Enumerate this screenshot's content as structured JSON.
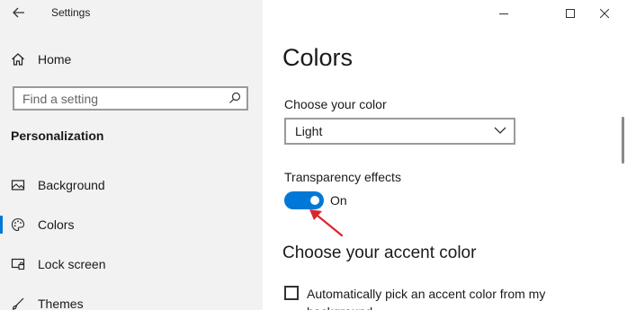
{
  "window": {
    "title": "Settings",
    "controls": [
      "minimize-icon",
      "maximize-icon",
      "close-icon"
    ]
  },
  "sidebar": {
    "home_label": "Home",
    "search": {
      "placeholder": "Find a setting",
      "icon": "search-icon"
    },
    "section_heading": "Personalization",
    "items": [
      {
        "label": "Background",
        "icon": "picture-icon",
        "selected": false
      },
      {
        "label": "Colors",
        "icon": "palette-icon",
        "selected": true
      },
      {
        "label": "Lock screen",
        "icon": "lock-screen-icon",
        "selected": false
      },
      {
        "label": "Themes",
        "icon": "brush-icon",
        "selected": false
      }
    ]
  },
  "main": {
    "page_title": "Colors",
    "choose_color": {
      "label": "Choose your color",
      "value": "Light"
    },
    "transparency": {
      "label": "Transparency effects",
      "state": "On",
      "on": true
    },
    "accent": {
      "heading": "Choose your accent color",
      "auto_pick_label": "Automatically pick an accent color from my background",
      "auto_pick_checked": false
    }
  },
  "colors": {
    "accent": "#0078d7",
    "sidebar_bg": "#f2f2f2",
    "annotation_arrow": "#d9262a"
  }
}
